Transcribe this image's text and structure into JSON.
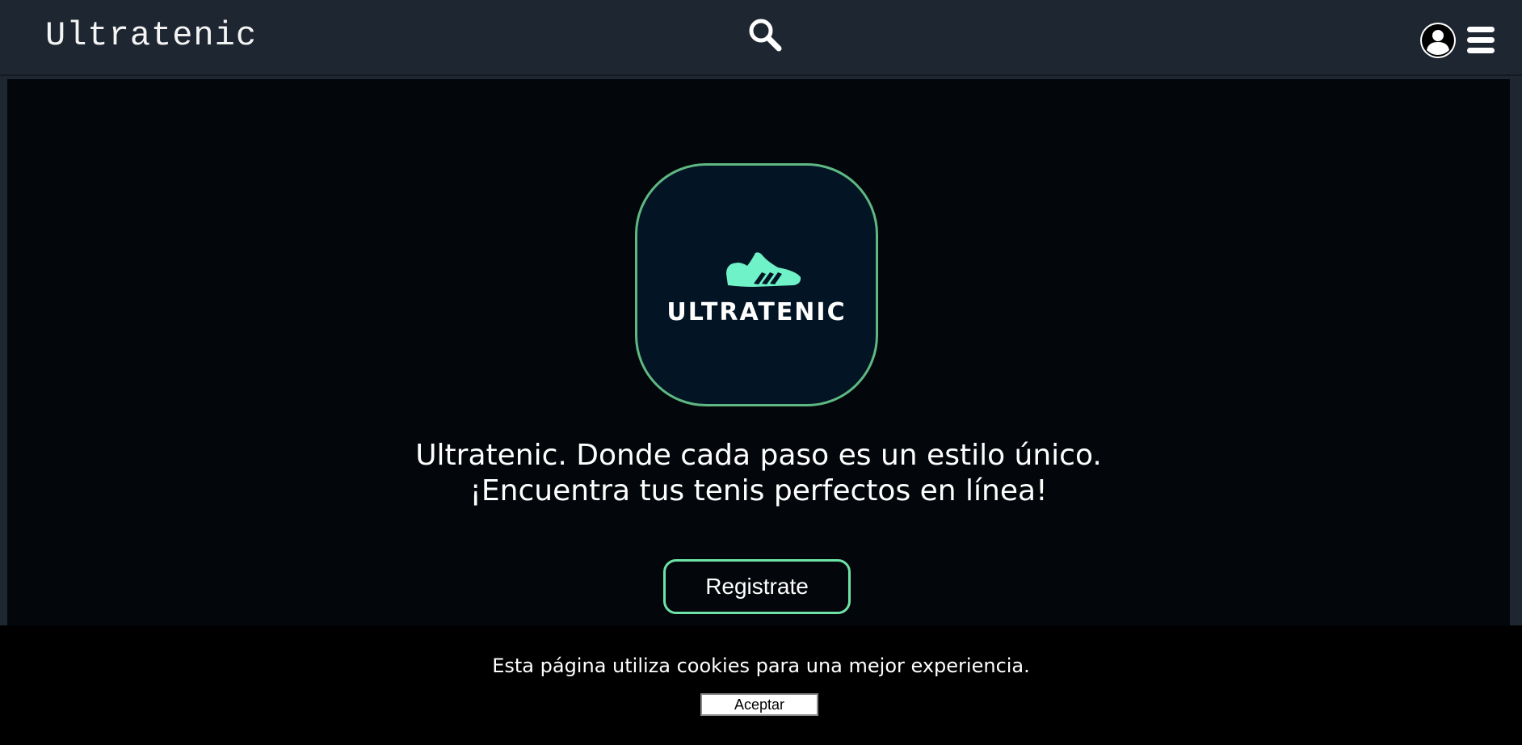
{
  "header": {
    "brand": "Ultratenic",
    "search_icon": "search-icon",
    "user_icon": "user-account-icon",
    "menu_icon": "hamburger-menu-icon"
  },
  "hero": {
    "logo_text": "ULTRATENIC",
    "logo_icon": "sneaker-icon",
    "tagline_line1": "Ultratenic. Donde cada paso es un estilo único.",
    "tagline_line2": "¡Encuentra tus tenis perfectos en línea!",
    "register_label": "Registrate"
  },
  "cookies": {
    "message": "Esta página utiliza cookies para una mejor experiencia.",
    "accept_label": "Aceptar"
  },
  "colors": {
    "header_bg": "#1e2631",
    "main_bg": "#03070b",
    "accent": "#6ee3a6",
    "logo_box_bg": "#031424",
    "logo_shoe": "#6ff2c8",
    "cookie_bg": "#000000"
  }
}
